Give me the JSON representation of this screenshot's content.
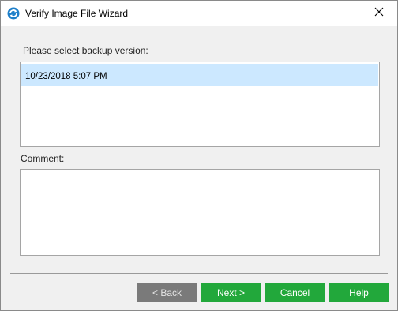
{
  "window": {
    "title": "Verify Image File Wizard",
    "icon": "wizard-app-icon",
    "close_icon": "close-icon"
  },
  "backup_version": {
    "label": "Please select backup version:",
    "items": [
      {
        "label": "10/23/2018 5:07 PM",
        "selected": true
      }
    ]
  },
  "comment": {
    "label": "Comment:",
    "value": ""
  },
  "buttons": {
    "back": "< Back",
    "next": "Next >",
    "cancel": "Cancel",
    "help": "Help"
  },
  "colors": {
    "accent_green": "#22a83b",
    "disabled_gray": "#7a7a7a",
    "selection_blue": "#cce8ff",
    "icon_blue": "#1e7fc9"
  }
}
